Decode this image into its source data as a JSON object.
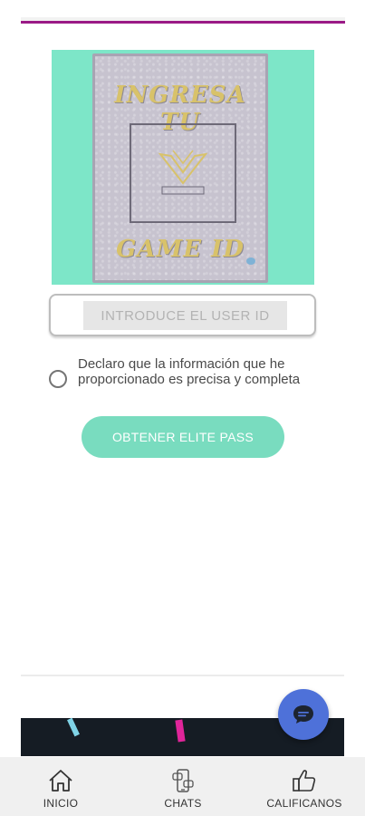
{
  "banner": {
    "title_line1": "INGRESA TU",
    "title_line2": "GAME ID",
    "background_color": "#7de6c8"
  },
  "form": {
    "userid_placeholder": "INTRODUCE EL USER ID",
    "userid_value": "",
    "declaration_text": "Declaro que la información que he proporcionado es precisa y completa",
    "declaration_checked": false,
    "submit_label": "OBTENER ELITE PASS"
  },
  "colors": {
    "accent": "#79dcbf",
    "divider": "#9a1a86",
    "fab": "#4e71d9"
  },
  "fab": {
    "icon": "chat-bubble-icon"
  },
  "tabbar": {
    "items": [
      {
        "label": "INICIO",
        "icon": "home-icon"
      },
      {
        "label": "CHATS",
        "icon": "chats-icon"
      },
      {
        "label": "CALIFICANOS",
        "icon": "thumbs-up-icon"
      }
    ]
  }
}
